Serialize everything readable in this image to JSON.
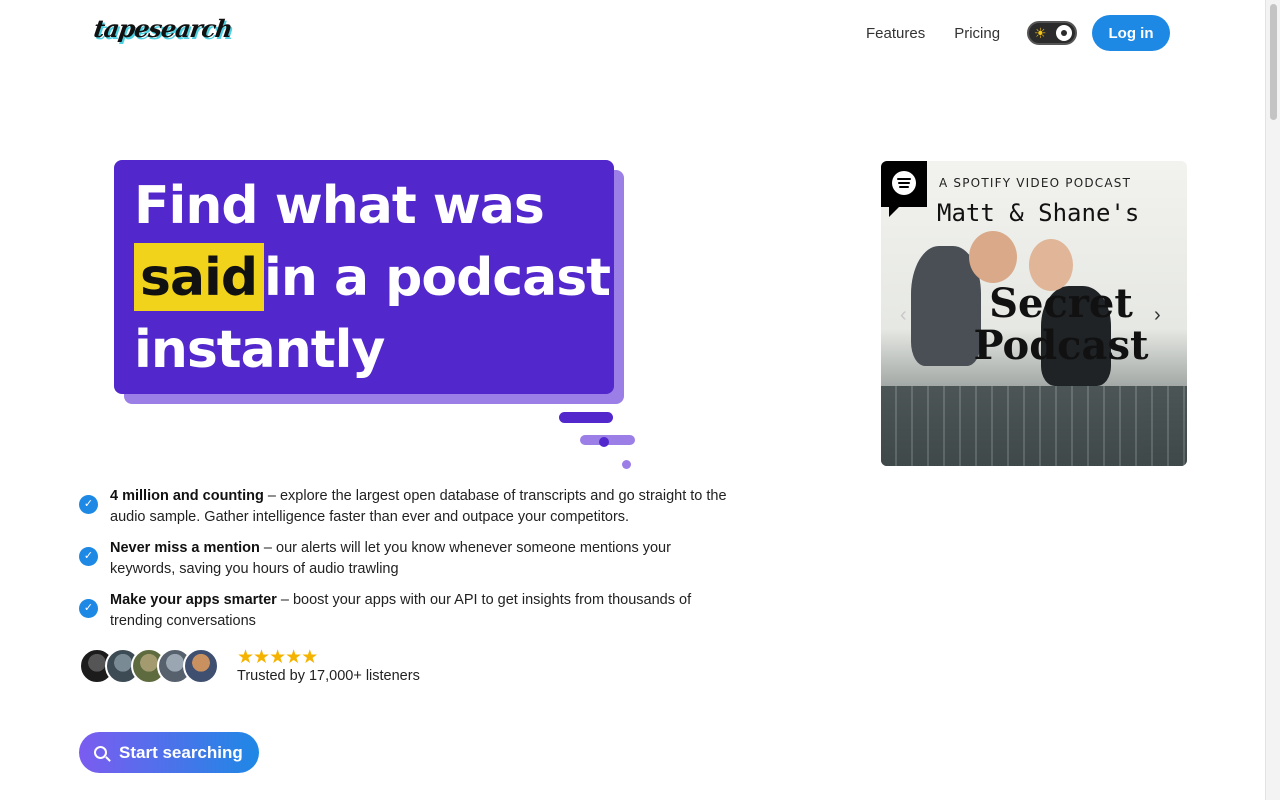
{
  "header": {
    "logo": "tapesearch",
    "nav": [
      "Features",
      "Pricing"
    ],
    "login_label": "Log in"
  },
  "hero": {
    "headline_line1": "Find what was",
    "headline_highlight": "said",
    "headline_line2_rest": "in a podcast",
    "headline_line3": "instantly"
  },
  "features": [
    {
      "bold": "4 million and counting",
      "text": " – explore the largest open database of transcripts and go straight to the audio sample. Gather intelligence faster than ever and outpace your competitors."
    },
    {
      "bold": "Never miss a mention",
      "text": " – our alerts will let you know whenever someone mentions your keywords, saving you hours of audio trawling"
    },
    {
      "bold": "Make your apps smarter",
      "text": " – boost your apps with our API to get insights from thousands of trending conversations"
    }
  ],
  "social_proof": {
    "rating": 5,
    "trusted_text": "Trusted by 17,000+ listeners"
  },
  "cta": {
    "label": "Start searching"
  },
  "podcast_card": {
    "subtitle": "A SPOTIFY VIDEO PODCAST",
    "show_name": "Matt & Shane's",
    "show_title_line1": "Secret",
    "show_title_line2": "Podcast"
  },
  "colors": {
    "accent_blue": "#1e88e5",
    "bubble_purple": "#5227cc",
    "bubble_light": "#9b7fe6",
    "highlight_yellow": "#f2d31b",
    "star_gold": "#f5b301"
  },
  "icons": [
    "sun-icon",
    "check-icon",
    "star-icon",
    "search-icon",
    "spotify-icon",
    "chevron-right-icon",
    "chevron-left-icon"
  ]
}
